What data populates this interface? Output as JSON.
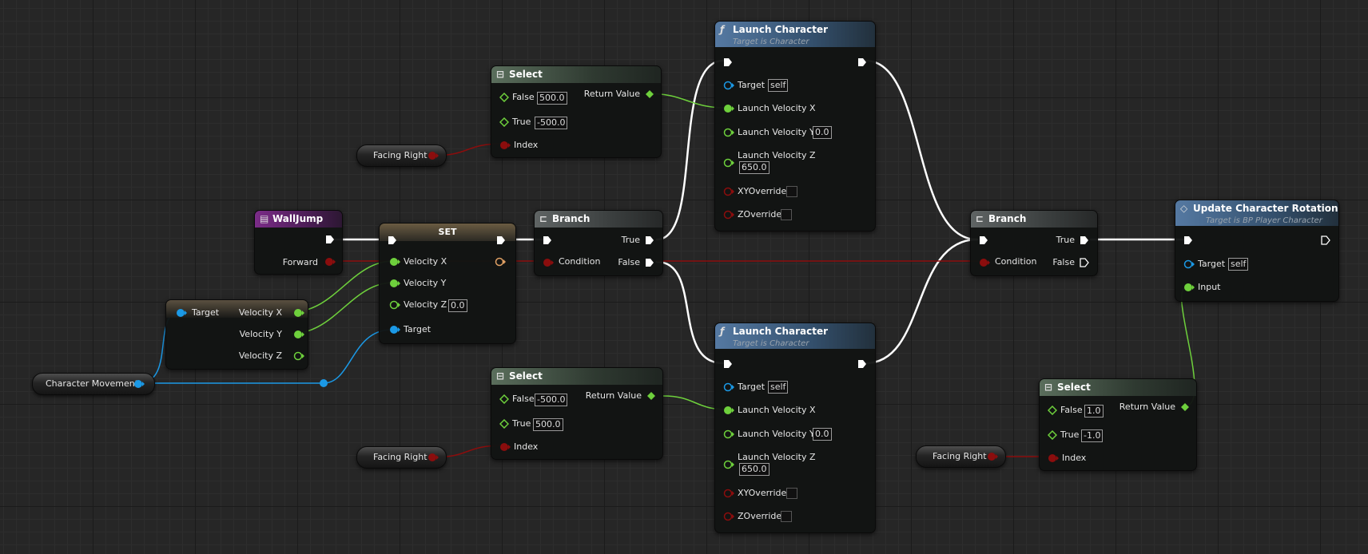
{
  "colors": {
    "exec": "#ffffff",
    "float": "#6ed03c",
    "bool": "#8b0d0d",
    "object": "#1b99e6",
    "struct_orange": "#e0a064"
  },
  "nodes": {
    "select_top": {
      "title": "Select",
      "false_label": "False",
      "false_value": "500.0",
      "true_label": "True",
      "true_value": "-500.0",
      "index_label": "Index",
      "return_label": "Return Value"
    },
    "select_mid": {
      "title": "Select",
      "false_label": "False",
      "false_value": "-500.0",
      "true_label": "True",
      "true_value": "500.0",
      "index_label": "Index",
      "return_label": "Return Value"
    },
    "select_right": {
      "title": "Select",
      "false_label": "False",
      "false_value": "1.0",
      "true_label": "True",
      "true_value": "-1.0",
      "index_label": "Index",
      "return_label": "Return Value"
    },
    "facing_right_labels": [
      "Facing Right",
      "Facing Right",
      "Facing Right"
    ],
    "walljump": {
      "title": "WallJump",
      "forward_label": "Forward"
    },
    "set_node": {
      "title": "SET",
      "vx_label": "Velocity X",
      "vy_label": "Velocity Y",
      "vz_label": "Velocity Z",
      "vz_value": "0.0",
      "target_label": "Target"
    },
    "break_node": {
      "target_label": "Target",
      "vx_label": "Velocity X",
      "vy_label": "Velocity Y",
      "vz_label": "Velocity Z"
    },
    "char_movement": {
      "label": "Character Movement"
    },
    "branch_left": {
      "title": "Branch",
      "condition_label": "Condition",
      "true_label": "True",
      "false_label": "False"
    },
    "branch_right": {
      "title": "Branch",
      "condition_label": "Condition",
      "true_label": "True",
      "false_label": "False"
    },
    "launch_top": {
      "title": "Launch Character",
      "subtitle": "Target is Character",
      "target_label": "Target",
      "target_value": "self",
      "lvx_label": "Launch Velocity X",
      "lvy_label": "Launch Velocity Y",
      "lvy_value": "0.0",
      "lvz_label": "Launch Velocity Z",
      "lvz_value": "650.0",
      "xy_label": "XYOverride",
      "z_label": "ZOverride"
    },
    "launch_bottom": {
      "title": "Launch Character",
      "subtitle": "Target is Character",
      "target_label": "Target",
      "target_value": "self",
      "lvx_label": "Launch Velocity X",
      "lvy_label": "Launch Velocity Y",
      "lvy_value": "0.0",
      "lvz_label": "Launch Velocity Z",
      "lvz_value": "650.0",
      "xy_label": "XYOverride",
      "z_label": "ZOverride"
    },
    "update_rotation": {
      "title": "Update Character Rotation",
      "subtitle": "Target is BP Player Character",
      "target_label": "Target",
      "target_value": "self",
      "input_label": "Input"
    }
  },
  "icons": {
    "select": "select-icon",
    "branch": "branch-icon",
    "function": "function-icon",
    "event": "event-icon",
    "update": "update-diamond-icon"
  }
}
